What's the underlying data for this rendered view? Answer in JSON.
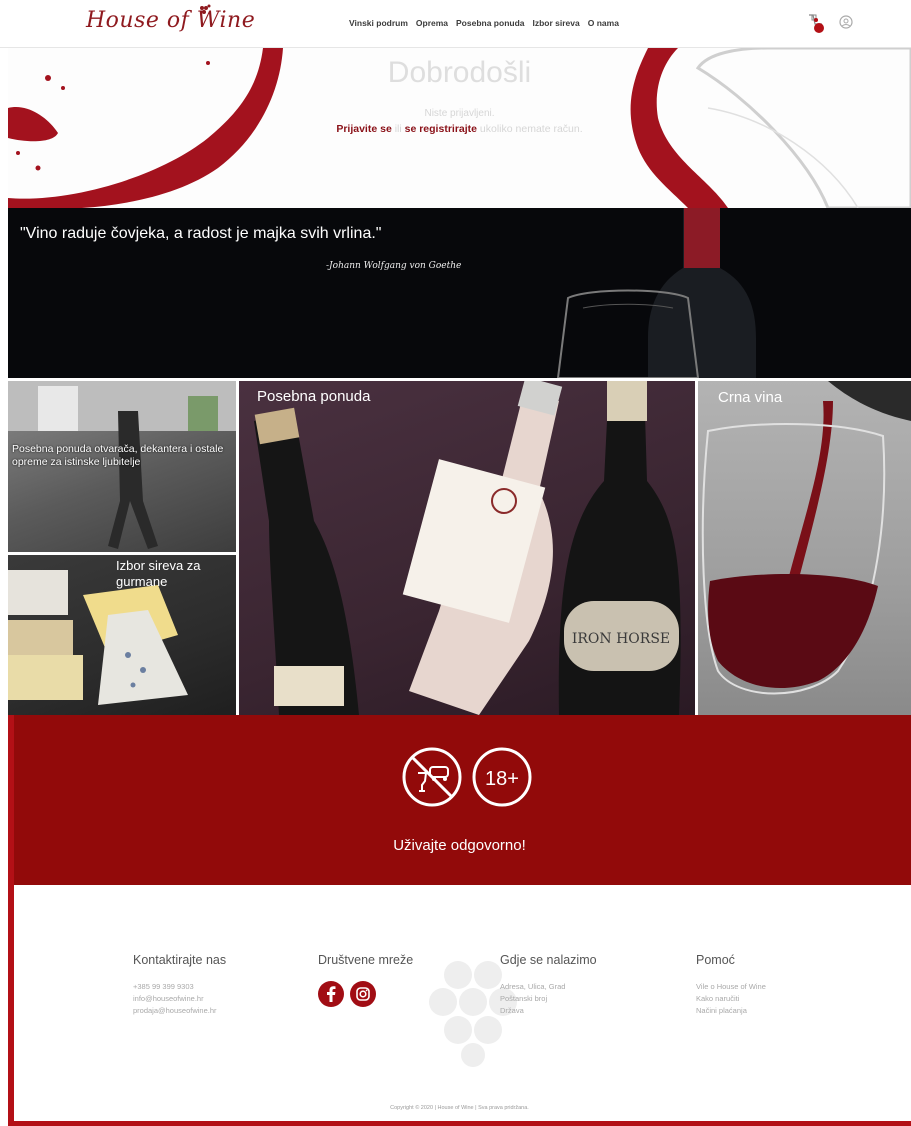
{
  "header": {
    "logo_text": "House of Wine",
    "nav": [
      "Vinski podrum",
      "Oprema",
      "Posebna ponuda",
      "Izbor sireva",
      "O nama"
    ]
  },
  "hero": {
    "title": "Dobrodošli",
    "subtitle": "Niste prijavljeni.",
    "login_link": "Prijavite se",
    "or_text": "ili",
    "register_link": "se registrirajte",
    "suffix": "ukoliko nemate račun."
  },
  "quote": {
    "text": "\"Vino raduje čovjeka, a radost je majka svih vrlina.\"",
    "author": "-Johann Wolfgang von Goethe"
  },
  "tiles": {
    "oprema": "Posebna ponuda otvarača, dekantera i ostale opreme za istinske ljubitelje",
    "sir": "Izbor sireva za gurmane",
    "posebna": "Posebna ponuda",
    "crna": "Crna vina"
  },
  "responsible": {
    "age_badge": "18+",
    "text": "Uživajte odgovorno!"
  },
  "footer": {
    "contact": {
      "title": "Kontaktirajte nas",
      "lines": [
        "+385 99 399 9303",
        "info@houseofwine.hr",
        "prodaja@houseofwine.hr"
      ]
    },
    "social": {
      "title": "Društvene mreže"
    },
    "location": {
      "title": "Gdje se nalazimo",
      "lines": [
        "Adresa, Ulica, Grad",
        "Poštanski broj",
        "Država"
      ]
    },
    "help": {
      "title": "Pomoć",
      "lines": [
        "Vile o House of Wine",
        "Kako naručiti",
        "Načini plaćanja"
      ]
    },
    "copyright": "Copyright © 2020 | House of Wine | Sva prava pridržana."
  },
  "colors": {
    "brand": "#8f1a1f",
    "band_red": "#920a0a",
    "accent_red": "#b31016"
  }
}
